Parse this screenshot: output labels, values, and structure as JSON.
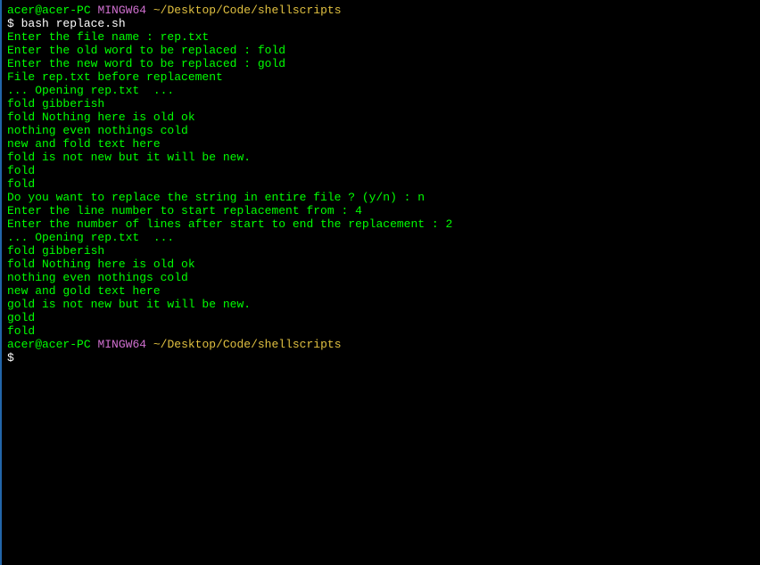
{
  "prompt1": {
    "user": "acer@acer-PC",
    "host": "MINGW64",
    "path": "~/Desktop/Code/shellscripts",
    "dollar": "$ ",
    "command": "bash replace.sh"
  },
  "lines": {
    "l1": "Enter the file name : rep.txt",
    "l2": "Enter the old word to be replaced : fold",
    "l3": "Enter the new word to be replaced : gold",
    "l4": "",
    "l5": "File rep.txt before replacement",
    "l6": "",
    "l7": "",
    "l8": "... Opening rep.txt  ...",
    "l9": "",
    "l10": "",
    "l11": "fold gibberish",
    "l12": "fold Nothing here is old ok",
    "l13": "nothing even nothings cold",
    "l14": "new and fold text here",
    "l15": "fold is not new but it will be new.",
    "l16": "fold",
    "l17": "fold",
    "l18": "",
    "l19": "",
    "l20": "Do you want to replace the string in entire file ? (y/n) : n",
    "l21": "Enter the line number to start replacement from : 4",
    "l22": "Enter the number of lines after start to end the replacement : 2",
    "l23": "",
    "l24": "... Opening rep.txt  ...",
    "l25": "",
    "l26": "",
    "l27": "fold gibberish",
    "l28": "fold Nothing here is old ok",
    "l29": "nothing even nothings cold",
    "l30": "new and gold text here",
    "l31": "gold is not new but it will be new.",
    "l32": "gold",
    "l33": "fold",
    "l34": "",
    "l35": ""
  },
  "prompt2": {
    "user": "acer@acer-PC",
    "host": "MINGW64",
    "path": "~/Desktop/Code/shellscripts",
    "dollar": "$"
  }
}
